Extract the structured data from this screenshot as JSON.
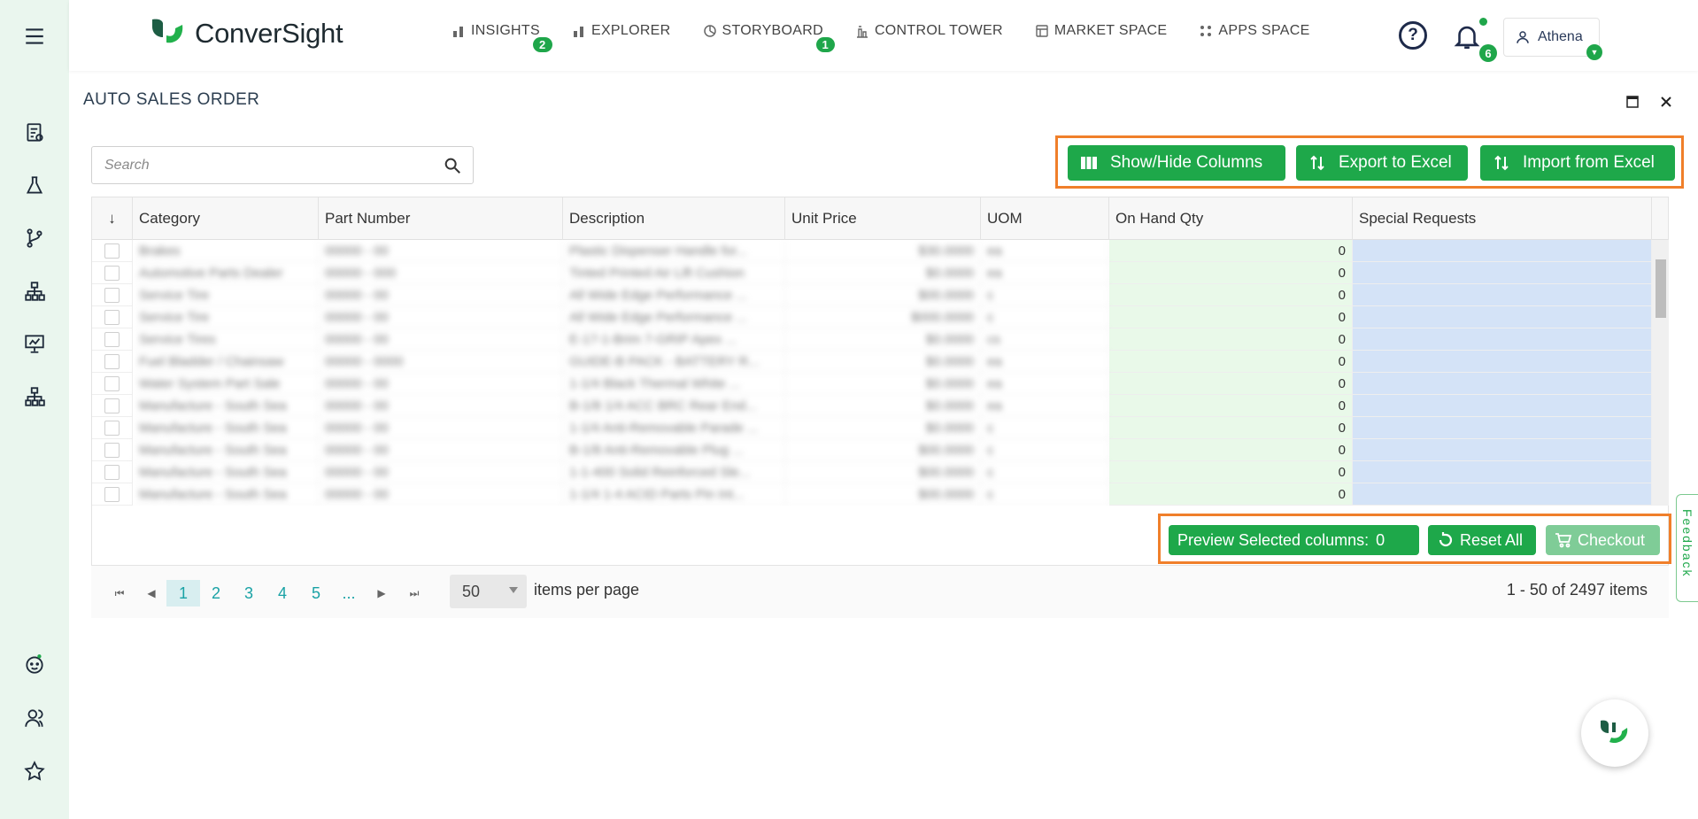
{
  "app": {
    "name": "ConverSight"
  },
  "nav": {
    "items": [
      {
        "label": "INSIGHTS",
        "badge": "2"
      },
      {
        "label": "EXPLORER",
        "badge": ""
      },
      {
        "label": "STORYBOARD",
        "badge": "1"
      },
      {
        "label": "CONTROL TOWER",
        "badge": ""
      },
      {
        "label": "MARKET SPACE",
        "badge": ""
      },
      {
        "label": "APPS SPACE",
        "badge": ""
      }
    ],
    "help_glyph": "?",
    "notifications_count": "6",
    "user_name": "Athena"
  },
  "panel": {
    "title": "AUTO SALES ORDER"
  },
  "search": {
    "placeholder": "Search"
  },
  "toolbar": {
    "show_hide": "Show/Hide Columns",
    "export": "Export to Excel",
    "import": "Import from Excel"
  },
  "table": {
    "sort_glyph": "↓",
    "columns": [
      "Category",
      "Part Number",
      "Description",
      "Unit Price",
      "UOM",
      "On Hand Qty",
      "Special Requests"
    ],
    "rows": [
      {
        "category": "Brakes",
        "part": "00000 - 00",
        "desc": "Plastic Dispenser Handle for...",
        "price": "$30.0000",
        "uom": "ea",
        "qty": "0"
      },
      {
        "category": "Automotive Parts Dealer",
        "part": "00000 - 000",
        "desc": "Tinted Printed Air Lift Cushion",
        "price": "$0.0000",
        "uom": "ea",
        "qty": "0"
      },
      {
        "category": "Service Tire",
        "part": "00000 - 00",
        "desc": "All Wide Edge Performance ...",
        "price": "$00.0000",
        "uom": "c",
        "qty": "0"
      },
      {
        "category": "Service Tire",
        "part": "00000 - 00",
        "desc": "All Wide Edge Performance ...",
        "price": "$000.0000",
        "uom": "c",
        "qty": "0"
      },
      {
        "category": "Service Tires",
        "part": "00000 - 00",
        "desc": "E-17-1-Brim 7-GRIP Apex ...",
        "price": "$0.0000",
        "uom": "cs",
        "qty": "0"
      },
      {
        "category": "Fuel Bladder / Chainsaw",
        "part": "00000 - 0000",
        "desc": "GUIDE-B PACK - BATTERY R...",
        "price": "$0.0000",
        "uom": "ea",
        "qty": "0"
      },
      {
        "category": "Water System Part Sale",
        "part": "00000 - 00",
        "desc": "1-1/4 Black Thermal White ...",
        "price": "$0.0000",
        "uom": "ea",
        "qty": "0"
      },
      {
        "category": "Manufacture - South Sea",
        "part": "00000 - 00",
        "desc": "B-1/8 1/4 ACC BRC Rear End...",
        "price": "$0.0000",
        "uom": "ea",
        "qty": "0"
      },
      {
        "category": "Manufacture - South Sea",
        "part": "00000 - 00",
        "desc": "1-1/4 Anti-Removable Parade ...",
        "price": "$0.0000",
        "uom": "c",
        "qty": "0"
      },
      {
        "category": "Manufacture - South Sea",
        "part": "00000 - 00",
        "desc": "B-1/8 Anti-Removable Plug ...",
        "price": "$00.0000",
        "uom": "c",
        "qty": "0"
      },
      {
        "category": "Manufacture - South Sea",
        "part": "00000 - 00",
        "desc": "1-1-400 Solid Reinforced Sle...",
        "price": "$00.0000",
        "uom": "c",
        "qty": "0"
      },
      {
        "category": "Manufacture - South Sea",
        "part": "00000 - 00",
        "desc": "1-1/4 1-4 ACID Parts Pin Int...",
        "price": "$00.0000",
        "uom": "c",
        "qty": "0"
      }
    ]
  },
  "actions": {
    "preview_label": "Preview Selected columns:",
    "preview_count": "0",
    "reset": "Reset All",
    "checkout": "Checkout"
  },
  "pager": {
    "first_glyph": "⏮",
    "prev_glyph": "◀",
    "next_glyph": "▶",
    "last_glyph": "⏭",
    "pages": [
      "1",
      "2",
      "3",
      "4",
      "5",
      "..."
    ],
    "per_page": "50",
    "per_page_label": "items per page",
    "range": "1 - 50 of 2497 items"
  },
  "feedback": {
    "label": "Feedback"
  },
  "icons": {
    "sidebar": [
      "menu-icon",
      "report-icon",
      "flask-icon",
      "branch-icon",
      "hierarchy-icon",
      "presentation-icon",
      "org-chart-icon",
      "bot-face-icon",
      "users-icon",
      "star-icon"
    ]
  },
  "colors": {
    "brand_green": "#1ea84a",
    "highlight_orange": "#f07f2a",
    "qty_bg": "#e9f9e9",
    "special_bg": "#d4e3f7",
    "sidebar_bg": "#eaf6ee"
  }
}
